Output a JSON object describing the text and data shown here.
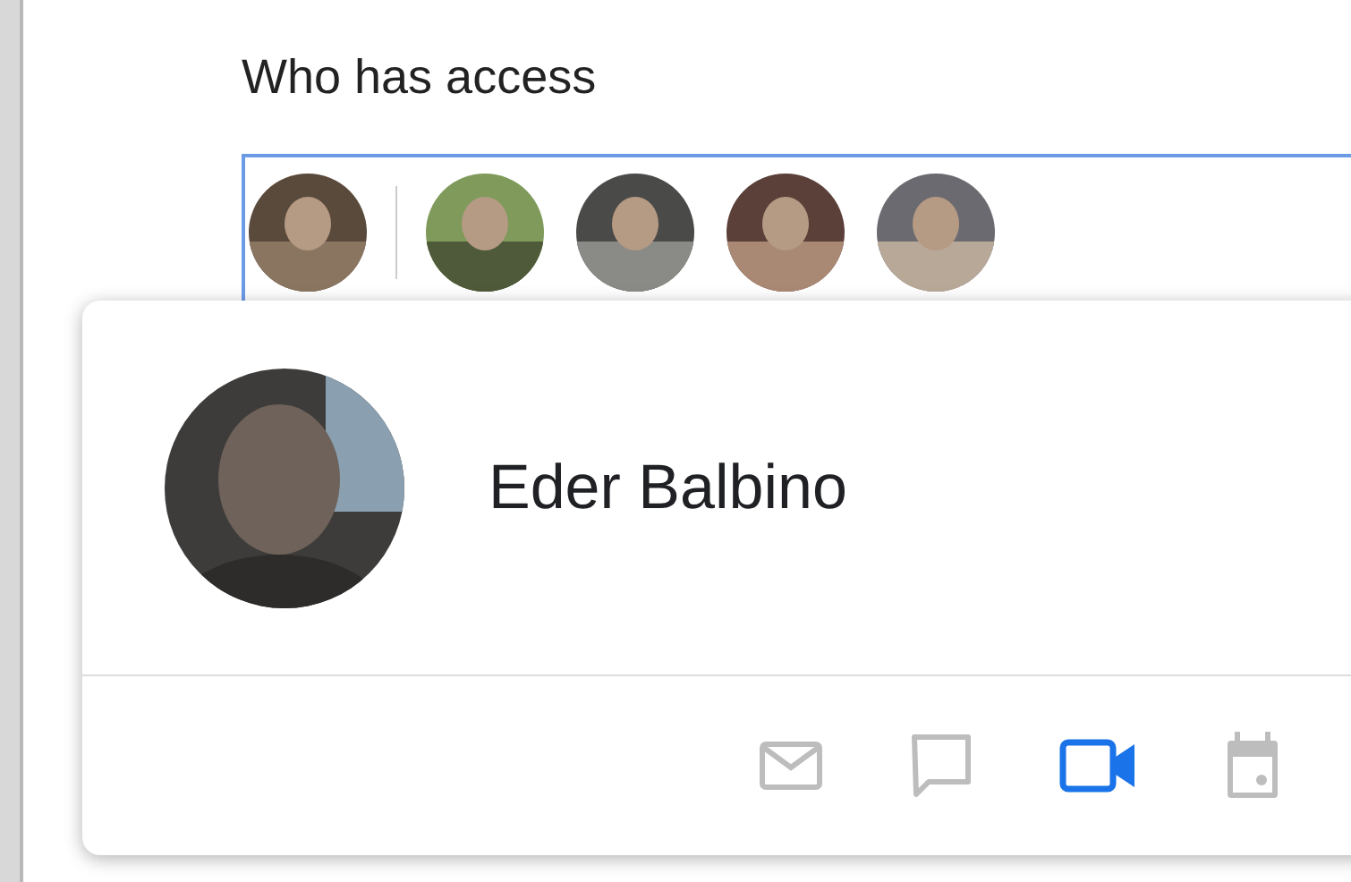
{
  "section_title": "Who has access",
  "people_field": {
    "focused": true
  },
  "person_card": {
    "name": "Eder Balbino",
    "actions": [
      {
        "kind": "mail",
        "active": false
      },
      {
        "kind": "chat",
        "active": false
      },
      {
        "kind": "video",
        "active": true
      },
      {
        "kind": "calendar",
        "active": false
      }
    ]
  }
}
